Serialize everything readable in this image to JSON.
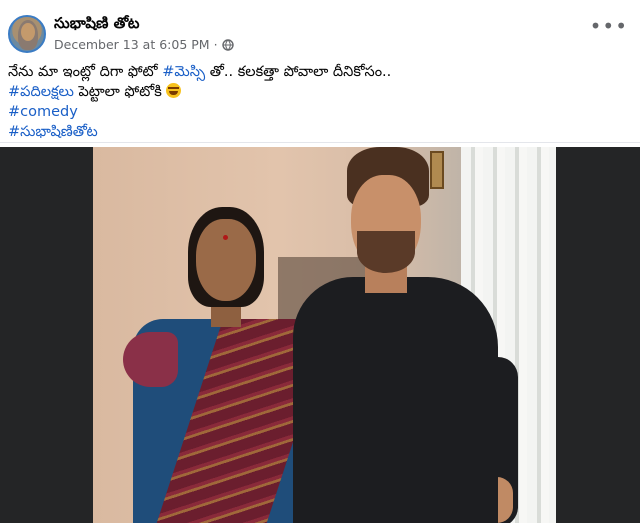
{
  "post": {
    "author": "సుభాషిణి తోట",
    "timestamp": "December 13 at 6:05 PM",
    "separator": "·",
    "privacy_icon": "globe-icon",
    "more_label": "•••",
    "text": {
      "line1_prefix": "నేను మా ఇంట్లో దిగా ఫోటో ",
      "line1_tag": "#మెస్సి",
      "line1_suffix": " తో.. కలకత్తా పోవాలా దీనికోసం..",
      "line2_tag": "#పదిలక్షలు",
      "line2_suffix": " పెట్టాలా ఫోటోకి",
      "line2_emoji": "rofl-emoji",
      "line3_tag": "#comedy",
      "line4_tag": "#సుభాషిణితోట"
    }
  },
  "colors": {
    "hashtag": "#1a5fc7",
    "meta": "#65676b",
    "photo_background": "#242526"
  }
}
